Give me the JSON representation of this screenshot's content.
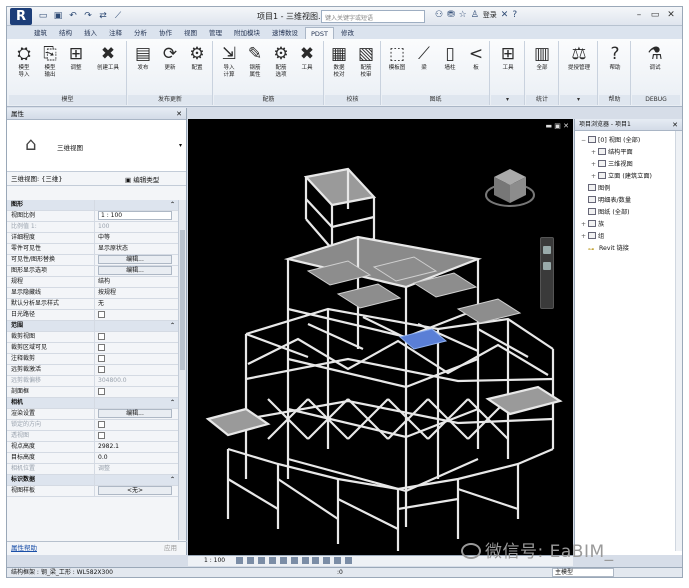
{
  "app": {
    "logo": "R",
    "title": "项目1 - 三维视图...",
    "search_placeholder": "键入关键字或短语",
    "login": "登录",
    "quick_access": [
      "open-icon",
      "save-icon",
      "undo-icon",
      "redo-icon",
      "measure-icon",
      "line-icon"
    ],
    "window_controls": [
      "minimize",
      "maximize",
      "close"
    ]
  },
  "tabs": [
    {
      "label": "建筑"
    },
    {
      "label": "结构"
    },
    {
      "label": "插入"
    },
    {
      "label": "注释"
    },
    {
      "label": "分析"
    },
    {
      "label": "协作"
    },
    {
      "label": "视图"
    },
    {
      "label": "管理"
    },
    {
      "label": "附加模块"
    },
    {
      "label": "速博数设"
    },
    {
      "label": "PDST",
      "active": true
    },
    {
      "label": "修改"
    }
  ],
  "ribbon": {
    "panels": [
      {
        "title": "模型",
        "buttons": [
          {
            "icon": "model-import-icon",
            "label": "模型\n导入"
          },
          {
            "icon": "model-export-icon",
            "label": "模型\n输出"
          },
          {
            "icon": "adjust-icon",
            "label": "调整"
          },
          {
            "icon": "create-tool-icon",
            "label": "创建工具"
          }
        ]
      },
      {
        "title": "发布更新",
        "buttons": [
          {
            "icon": "publish-icon",
            "label": "发布"
          },
          {
            "icon": "update-icon",
            "label": "更新"
          },
          {
            "icon": "configure-icon",
            "label": "配置"
          }
        ]
      },
      {
        "title": "配筋",
        "buttons": [
          {
            "icon": "import-calc-icon",
            "label": "导入\n计算"
          },
          {
            "icon": "rebar-property-icon",
            "label": "钢筋\n属性"
          },
          {
            "icon": "rebar-option-icon",
            "label": "配筋\n选项"
          },
          {
            "icon": "tools-icon",
            "label": "工具"
          }
        ]
      },
      {
        "title": "校核",
        "buttons": [
          {
            "icon": "data-check-icon",
            "label": "数据\n校对"
          },
          {
            "icon": "rebar-check-icon",
            "label": "配筋\n校审"
          }
        ]
      },
      {
        "title": "图纸",
        "buttons": [
          {
            "icon": "template-icon",
            "label": "模板图"
          },
          {
            "icon": "beam-icon",
            "label": "梁"
          },
          {
            "icon": "column-icon",
            "label": "墙柱"
          },
          {
            "icon": "slab-icon",
            "label": "板"
          }
        ]
      },
      {
        "title": "",
        "buttons": [
          {
            "icon": "tool-icon",
            "label": "工具"
          }
        ]
      },
      {
        "title": "统计",
        "buttons": [
          {
            "icon": "all-stats-icon",
            "label": "全部"
          }
        ]
      },
      {
        "title": "",
        "buttons": [
          {
            "icon": "load-config-icon",
            "label": "提授管理"
          }
        ]
      },
      {
        "title": "帮助",
        "buttons": [
          {
            "icon": "help-icon",
            "label": "帮助"
          }
        ]
      },
      {
        "title": "DEBUG",
        "buttons": [
          {
            "icon": "debug-icon",
            "label": "调试"
          }
        ]
      }
    ]
  },
  "properties": {
    "title": "属性",
    "type_name": "三维视图",
    "view_selector": "三维视图: {三维}",
    "edit_type": "编辑类型",
    "rows": [
      {
        "k": "图形",
        "v": "",
        "kind": "section"
      },
      {
        "k": "视图比例",
        "v": "1 : 100",
        "kind": "input"
      },
      {
        "k": "比例值 1:",
        "v": "100",
        "kind": "dim"
      },
      {
        "k": "详细程度",
        "v": "中等"
      },
      {
        "k": "零件可见性",
        "v": "显示原状态"
      },
      {
        "k": "可见性/图形替换",
        "v": "编辑...",
        "kind": "button"
      },
      {
        "k": "图形显示选项",
        "v": "编辑...",
        "kind": "button"
      },
      {
        "k": "规程",
        "v": "结构"
      },
      {
        "k": "显示隐藏线",
        "v": "按规程"
      },
      {
        "k": "默认分析显示样式",
        "v": "无"
      },
      {
        "k": "日光路径",
        "v": "",
        "kind": "check"
      },
      {
        "k": "范围",
        "v": "",
        "kind": "section"
      },
      {
        "k": "裁剪视图",
        "v": "",
        "kind": "check"
      },
      {
        "k": "裁剪区域可见",
        "v": "",
        "kind": "check"
      },
      {
        "k": "注释裁剪",
        "v": "",
        "kind": "check"
      },
      {
        "k": "远剪裁激活",
        "v": "",
        "kind": "check"
      },
      {
        "k": "远剪裁偏移",
        "v": "304800.0",
        "kind": "dim"
      },
      {
        "k": "剖面框",
        "v": "",
        "kind": "check"
      },
      {
        "k": "相机",
        "v": "",
        "kind": "section"
      },
      {
        "k": "渲染设置",
        "v": "编辑...",
        "kind": "button"
      },
      {
        "k": "锁定的方向",
        "v": "",
        "kind": "dimcheck"
      },
      {
        "k": "透视图",
        "v": "",
        "kind": "dimcheck"
      },
      {
        "k": "视点高度",
        "v": "2982.1"
      },
      {
        "k": "目标高度",
        "v": "0.0"
      },
      {
        "k": "相机位置",
        "v": "调整",
        "kind": "dim"
      },
      {
        "k": "标识数据",
        "v": "",
        "kind": "section"
      },
      {
        "k": "视图样板",
        "v": "<无>",
        "kind": "button"
      }
    ],
    "help_link": "属性帮助",
    "apply": "应用"
  },
  "viewport": {
    "background": "#000000",
    "model_color": "#e6e6e6",
    "selected_color": "#5a7fd6",
    "scale": "1 : 100"
  },
  "browser": {
    "title": "项目浏览器 - 项目1",
    "nodes": [
      {
        "label": "[0] 视图 (全部)",
        "level": 0,
        "toggle": "−"
      },
      {
        "label": "结构平面",
        "level": 1,
        "toggle": "+"
      },
      {
        "label": "三维视图",
        "level": 1,
        "toggle": "+"
      },
      {
        "label": "立面 (建筑立面)",
        "level": 1,
        "toggle": "+"
      },
      {
        "label": "图例",
        "level": 0,
        "toggle": ""
      },
      {
        "label": "明细表/数量",
        "level": 0,
        "toggle": ""
      },
      {
        "label": "图纸 (全部)",
        "level": 0,
        "toggle": ""
      },
      {
        "label": "族",
        "level": 0,
        "toggle": "+"
      },
      {
        "label": "组",
        "level": 0,
        "toggle": "+"
      },
      {
        "label": "Revit 链接",
        "level": 0,
        "toggle": "",
        "link": true
      }
    ]
  },
  "status": {
    "left": "结构框架 : 钢_梁_工形 : WL582X300",
    "zero": ":0",
    "mm": "主模型"
  },
  "watermark": "微信号: EaBIM_"
}
